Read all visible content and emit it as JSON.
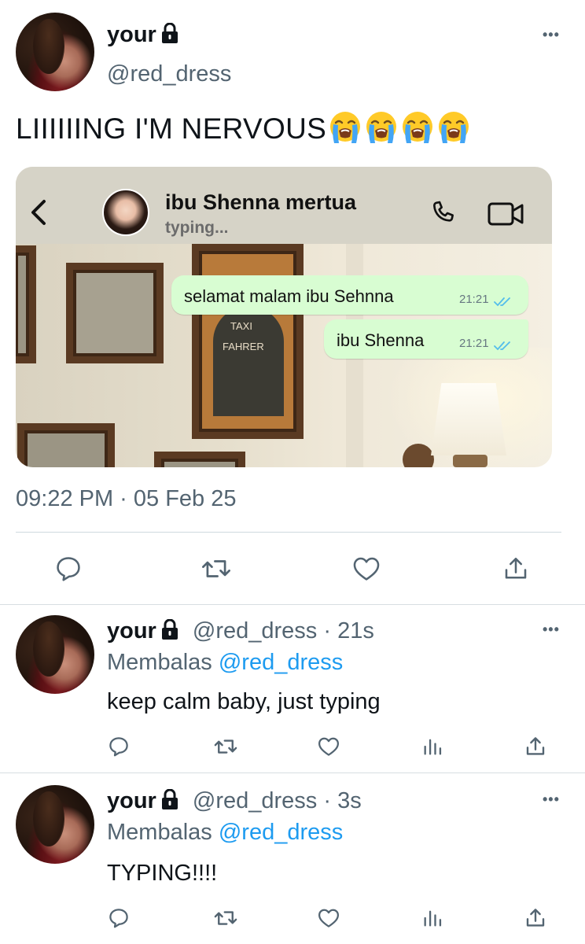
{
  "main_tweet": {
    "display_name": "your",
    "handle": "@red_dress",
    "text": "LIIIIIING I'M NERVOUS",
    "emoji_count": 4,
    "emoji": "loudly-crying-face",
    "timestamp": "09:22 PM · 05 Feb 25"
  },
  "chat_screenshot": {
    "contact_name": "ibu Shenna mertua",
    "status": "typing...",
    "messages": [
      {
        "text": "selamat malam ibu Sehnna",
        "time": "21:21"
      },
      {
        "text": "ibu Shenna",
        "time": "21:21"
      }
    ],
    "picture_signs": [
      "TAXI",
      "FAHRER"
    ]
  },
  "replies": [
    {
      "display_name": "your",
      "handle": "@red_dress",
      "age": "· 21s",
      "replying_prefix": "Membalas",
      "replying_to": "@red_dress",
      "text": "keep calm baby, just typing"
    },
    {
      "display_name": "your",
      "handle": "@red_dress",
      "age": "· 3s",
      "replying_prefix": "Membalas",
      "replying_to": "@red_dress",
      "text": "TYPING!!!!"
    }
  ],
  "more_label": "•••",
  "colors": {
    "text": "#0f1419",
    "secondary": "#536471",
    "link": "#1d9bf0",
    "bubble": "#d8fdd2",
    "read_ticks": "#53bdeb"
  }
}
